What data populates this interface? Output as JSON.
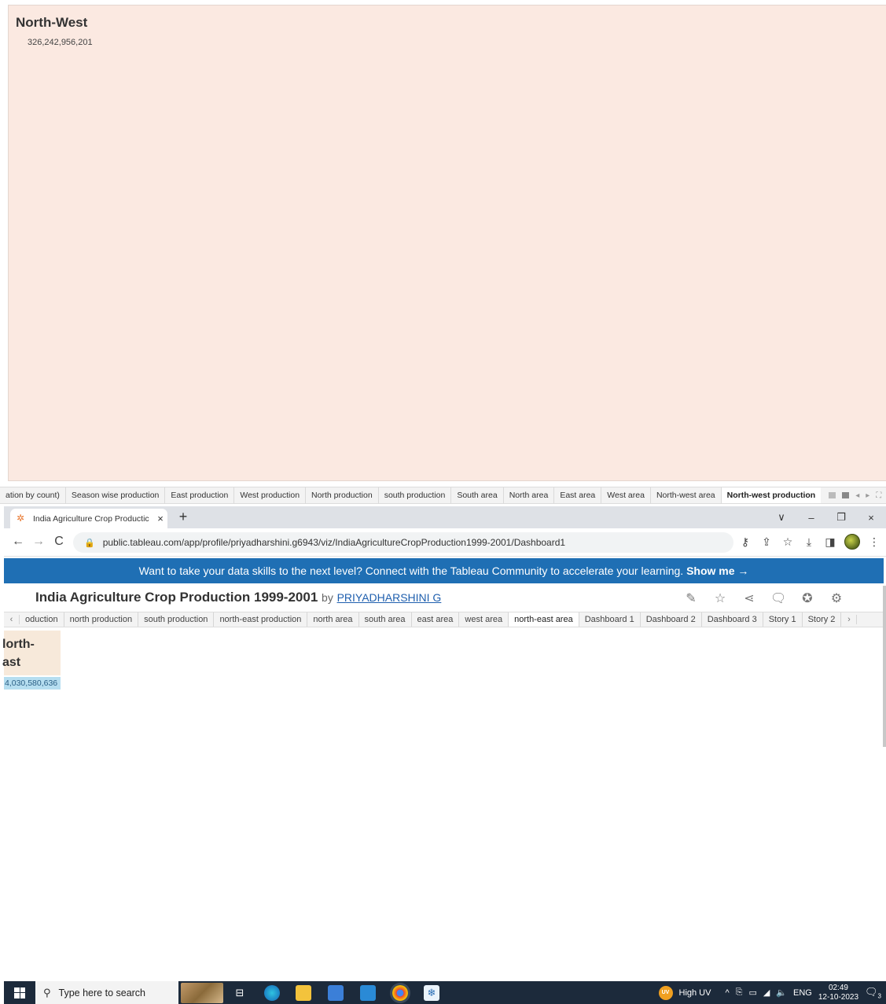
{
  "top_viz": {
    "title": "North-West",
    "value": "326,242,956,201",
    "background": "#fbe9e1"
  },
  "top_tabs": {
    "items": [
      "ation by count)",
      "Season wise production",
      "East production",
      "West production",
      "North production",
      "south production",
      "South area",
      "North area",
      "East area",
      "West area",
      "North-west area",
      "North-west production"
    ],
    "active": "North-west production"
  },
  "browser": {
    "tab_title": "India Agriculture Crop Productic",
    "tab_close": "×",
    "new_tab": "+",
    "url": "public.tableau.com/app/profile/priyadharshini.g6943/viz/IndiaAgricultureCropProduction1999-2001/Dashboard1",
    "window_controls": [
      "∨",
      "–",
      "❐",
      "×"
    ]
  },
  "banner": {
    "text": "Want to take your data skills to the next level? Connect with the Tableau Community to accelerate your learning.",
    "cta": "Show me →",
    "color": "#1f6fb4"
  },
  "viz_header": {
    "title": "India Agriculture Crop Production 1999-2001",
    "by": "by",
    "author": "PRIYADHARSHINI G"
  },
  "sheet_tabs": {
    "items": [
      "oduction",
      "north production",
      "south production",
      "north-east production",
      "north area",
      "south area",
      "east area",
      "west area",
      "north-east area",
      "Dashboard 1",
      "Dashboard 2",
      "Dashboard 3",
      "Story 1",
      "Story 2"
    ],
    "active": "north-east area"
  },
  "ne_card": {
    "title": "lorth-\nast",
    "value": "4,030,580,636"
  },
  "taskbar": {
    "search_placeholder": "Type here to search",
    "weather": "High UV",
    "uv_badge": "UV",
    "lang": "ENG",
    "time": "02:49",
    "date": "12-10-2023",
    "notification_count": "3"
  }
}
